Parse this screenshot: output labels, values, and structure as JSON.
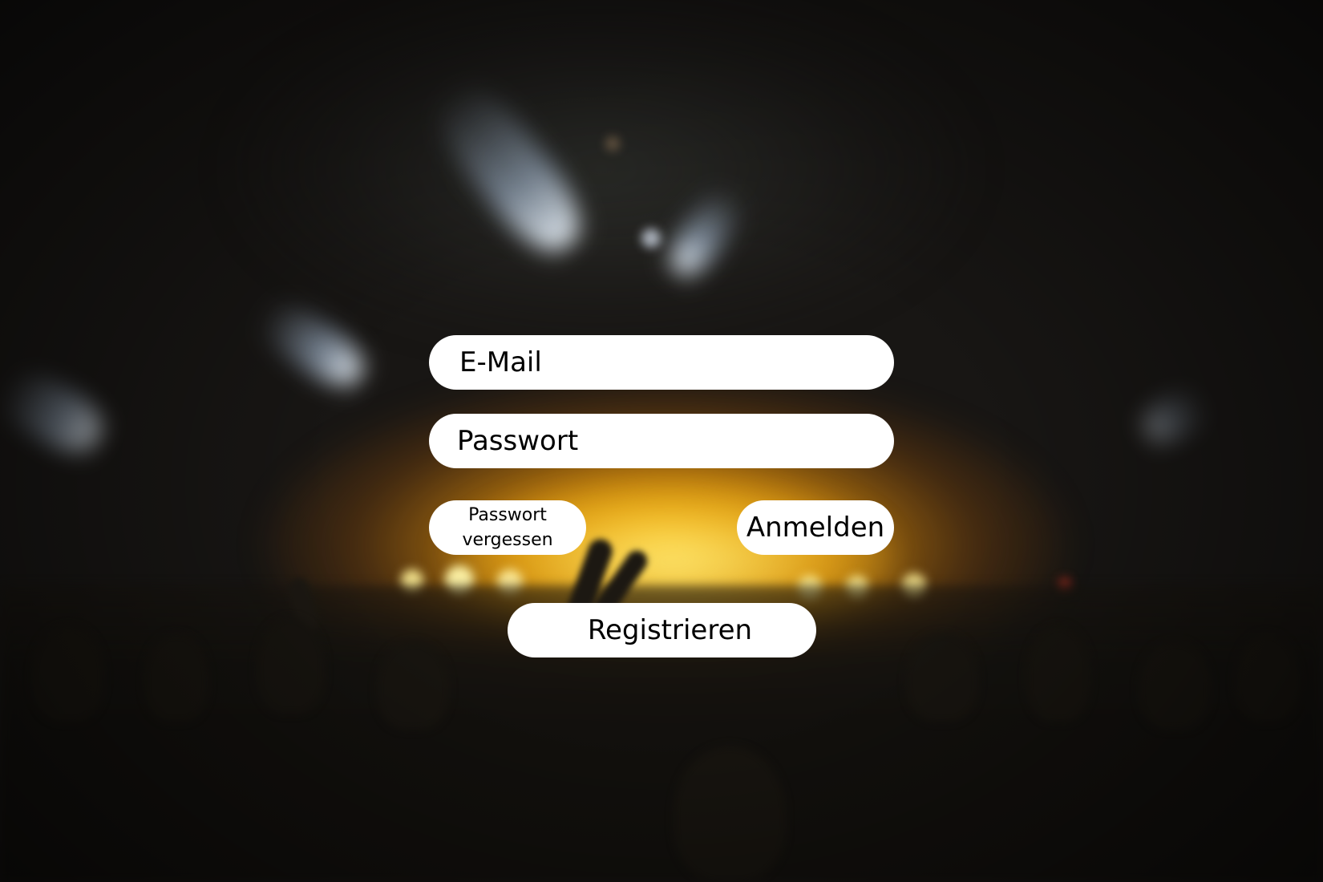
{
  "form": {
    "email_placeholder": "E-Mail",
    "password_placeholder": "Passwort",
    "forgot_password_line1": "Passwort",
    "forgot_password_line2": "vergessen",
    "login_label": "Anmelden",
    "register_label": "Registrieren"
  },
  "colors": {
    "control_background": "#ffffff",
    "text": "#000000",
    "stage_glow": "#ffc014"
  },
  "background": {
    "icon": "concert-crowd-photo"
  }
}
